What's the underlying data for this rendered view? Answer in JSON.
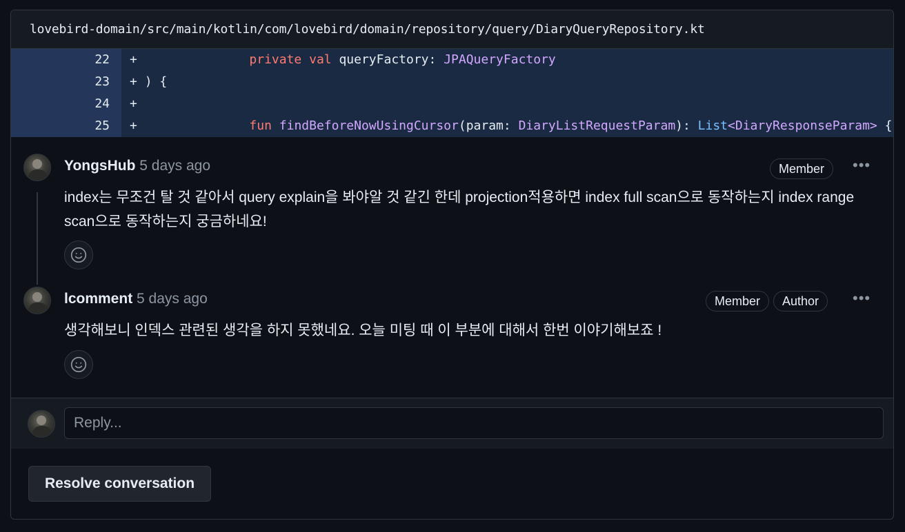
{
  "file": {
    "path": "lovebird-domain/src/main/kotlin/com/lovebird/domain/repository/query/DiaryQueryRepository.kt"
  },
  "diff": {
    "lines": [
      {
        "number": "22",
        "sign": "+",
        "indent": "        ",
        "t1": "private val",
        "t2": " queryFactory",
        "t3": ": ",
        "t4": "JPAQueryFactory",
        "t5": "",
        "t6": "",
        "t7": "",
        "t8": "",
        "t9": "",
        "t10": ""
      },
      {
        "number": "23",
        "sign": "+",
        "indent": "",
        "t1": "",
        "t2": ") {",
        "t3": "",
        "t4": "",
        "t5": "",
        "t6": "",
        "t7": "",
        "t8": "",
        "t9": "",
        "t10": ""
      },
      {
        "number": "24",
        "sign": "+",
        "indent": "",
        "t1": "",
        "t2": "",
        "t3": "",
        "t4": "",
        "t5": "",
        "t6": "",
        "t7": "",
        "t8": "",
        "t9": "",
        "t10": ""
      },
      {
        "number": "25",
        "sign": "+",
        "indent": "        ",
        "t1": "fun",
        "t2": " ",
        "t3": "findBeforeNowUsingCursor",
        "t4": "(param",
        "t5": ": ",
        "t6": "DiaryListRequestParam",
        "t7": "): ",
        "t8": "List",
        "t9": "<DiaryResponseParam>",
        "t10": " {"
      }
    ]
  },
  "comments": [
    {
      "author": "YongsHub",
      "time": "5 days ago",
      "badges": [
        "Member"
      ],
      "body": "index는 무조건 탈 것 같아서 query explain을 봐야알 것 같긴 한데 projection적용하면 index full scan으로 동작하는지 index range scan으로 동작하는지 궁금하네요!"
    },
    {
      "author": "lcomment",
      "time": "5 days ago",
      "badges": [
        "Member",
        "Author"
      ],
      "body": "생각해보니 인덱스 관련된 생각을 하지 못했네요. 오늘 미팅 때 이 부분에 대해서 한번 이야기해보죠 !"
    }
  ],
  "reply": {
    "placeholder": "Reply..."
  },
  "actions": {
    "resolve_label": "Resolve conversation"
  },
  "icons": {
    "more": "kebab-horizontal-icon",
    "reaction": "smiley-icon"
  }
}
